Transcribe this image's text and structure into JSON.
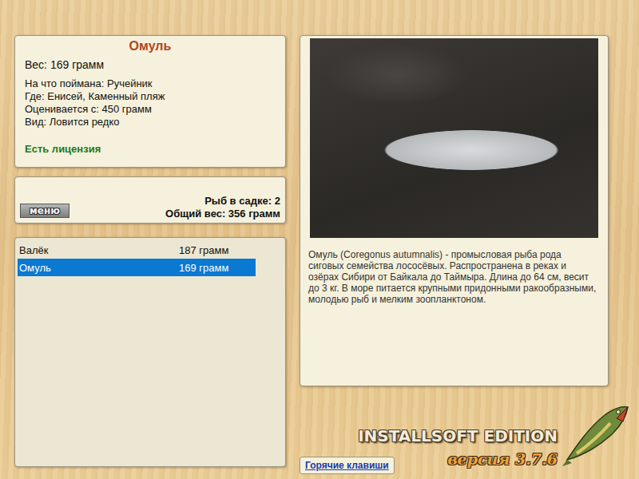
{
  "fish_card": {
    "title": "Омуль",
    "weight": "Вес: 169 грамм",
    "details": [
      "На что поймана: Ручейник",
      "Где: Енисей, Каменный пляж",
      "Оценивается с: 450 грамм",
      "Вид: Ловится редко"
    ],
    "license": "Есть лицензия"
  },
  "keepnet": {
    "menu_button": "меню",
    "count": "Рыб в садке: 2",
    "total": "Общий вес: 356 грамм"
  },
  "catch_list": [
    {
      "name": "Валёк",
      "weight": "187 грамм",
      "selected": false
    },
    {
      "name": "Омуль",
      "weight": "169 грамм",
      "selected": true
    }
  ],
  "description": "Омуль (Coregonus autumnalis) - промысловая рыба рода сиговых семейства лососёвых. Распространена в реках и озёрах Сибири от Байкала до Таймыра. Длина до 64 см, весит до 3 кг. В море питается крупными придонными ракообразными, молодью рыб и мелким зоопланктоном.",
  "branding": {
    "edition": "INSTALLSOFT EDITION",
    "version": "версия 3.7.6"
  },
  "hotkeys_button": "Горячие клавиши"
}
